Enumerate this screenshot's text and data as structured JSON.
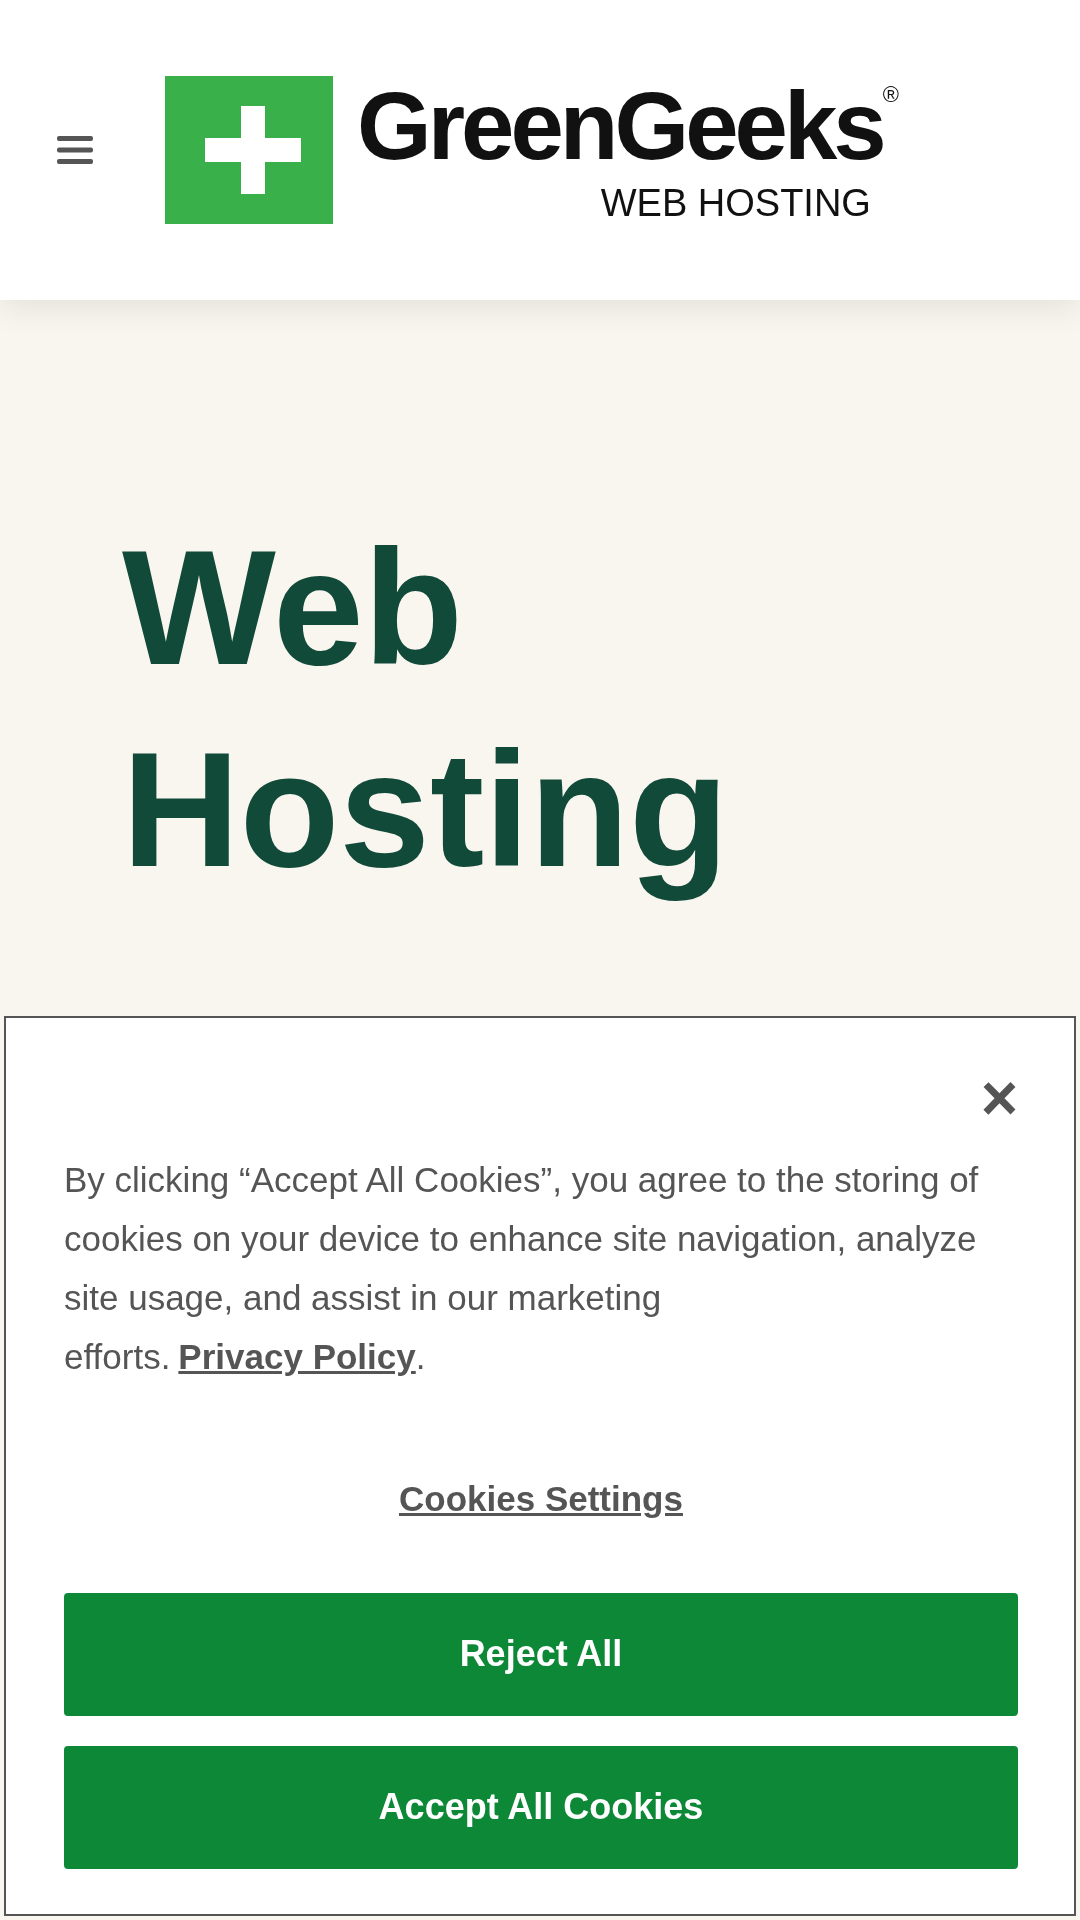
{
  "header": {
    "logo": {
      "name": "GreenGeeks",
      "tagline": "WEB HOSTING",
      "mark": "®"
    }
  },
  "hero": {
    "title_lines": [
      "Web",
      "Hosting"
    ]
  },
  "cookie_banner": {
    "close": "×",
    "text": "By clicking “Accept All Cookies”, you agree to the storing of cookies on your device to enhance site navigation, analyze site usage, and assist in our marketing efforts.",
    "policy_link": "Privacy Policy",
    "after_link": ".",
    "settings_link": "Cookies Settings",
    "buttons": [
      "Reject All",
      "Accept All Cookies"
    ]
  }
}
